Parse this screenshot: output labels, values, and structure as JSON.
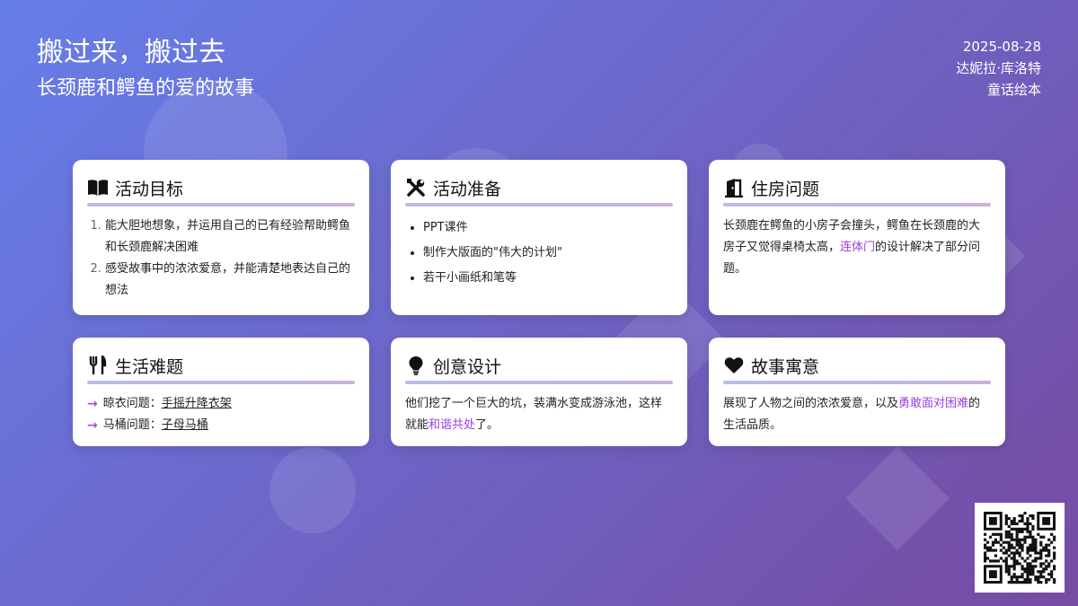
{
  "header": {
    "title": "搬过来，搬过去",
    "subtitle": "长颈鹿和鳄鱼的爱的故事",
    "date": "2025-08-28",
    "author": "达妮拉·库洛特",
    "category": "童话绘本"
  },
  "cards": {
    "goals": {
      "icon": "book-open-icon",
      "title": "活动目标",
      "items": [
        "能大胆地想象，并运用自己的已有经验帮助鳄鱼和长颈鹿解决困难",
        "感受故事中的浓浓爱意，并能清楚地表达自己的想法"
      ]
    },
    "prep": {
      "icon": "tools-icon",
      "title": "活动准备",
      "items": [
        "PPT课件",
        "制作大版面的\"伟大的计划\"",
        "若干小画纸和笔等"
      ]
    },
    "housing": {
      "icon": "door-icon",
      "title": "住房问题",
      "text_before": "长颈鹿在鳄鱼的小房子会撞头，鳄鱼在长颈鹿的大房子又觉得桌椅太高，",
      "highlight": "连体门",
      "text_after": "的设计解决了部分问题。"
    },
    "life": {
      "icon": "utensils-icon",
      "title": "生活难题",
      "rows": [
        {
          "label": "晾衣问题：",
          "value": "手摇升降衣架"
        },
        {
          "label": "马桶问题：",
          "value": "子母马桶"
        }
      ]
    },
    "creative": {
      "icon": "lightbulb-icon",
      "title": "创意设计",
      "text_before": "他们挖了一个巨大的坑，装满水变成游泳池，这样就能",
      "highlight": "和谐共处",
      "text_after": "了。"
    },
    "moral": {
      "icon": "heart-icon",
      "title": "故事寓意",
      "text_before": "展现了人物之间的浓浓爱意，以及",
      "highlight": "勇敢面对困难",
      "text_after": "的生活品质。"
    }
  },
  "qr": {
    "icon": "qr-code-icon"
  },
  "colors": {
    "bg_start": "#667eea",
    "bg_end": "#764ba2",
    "accent": "#9b3fe0"
  }
}
